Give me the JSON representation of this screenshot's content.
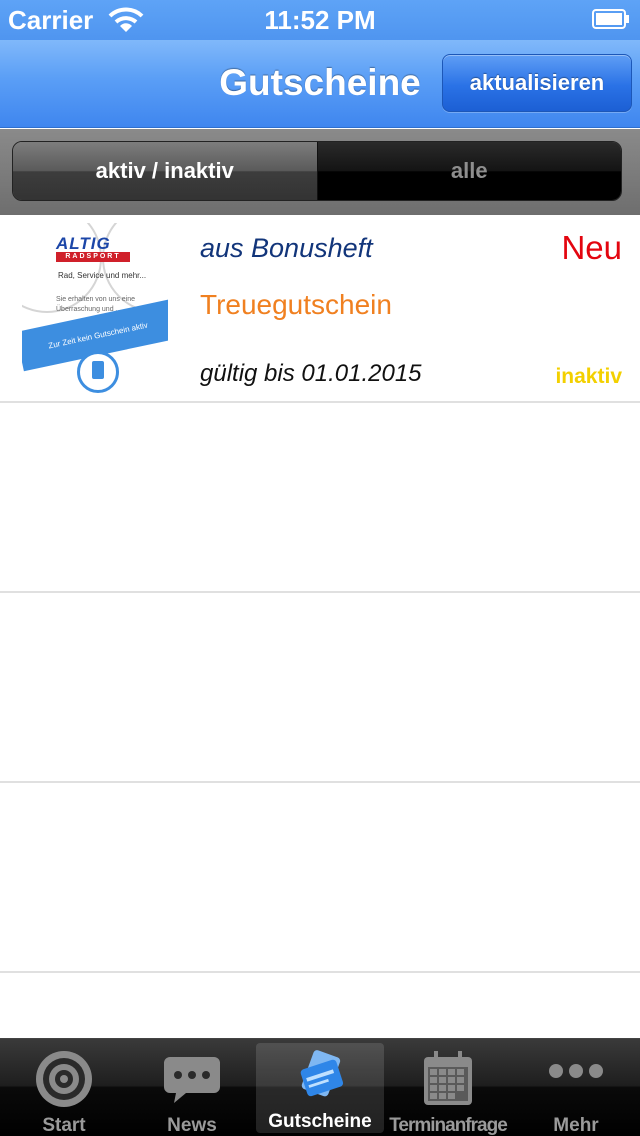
{
  "status_bar": {
    "carrier": "Carrier",
    "time": "11:52 PM"
  },
  "nav_bar": {
    "title": "Gutscheine",
    "refresh_label": "aktualisieren"
  },
  "segment": {
    "items": [
      {
        "label": "aktiv / inaktiv",
        "selected": true
      },
      {
        "label": "alle",
        "selected": false
      }
    ]
  },
  "vouchers": [
    {
      "source": "aus Bonusheft",
      "badge": "Neu",
      "name": "Treuegutschein",
      "valid": "gültig bis 01.01.2015",
      "status": "inaktiv",
      "thumbnail": {
        "logo": "ALTIG",
        "logo_sub": "RADSPORT",
        "tagline": "Rad, Service und mehr...",
        "text_line1": "Sie erhalten von uns eine",
        "text_line2": "Überraschung und ...",
        "banner": "Zur Zeit kein Gutschein aktiv"
      }
    }
  ],
  "tab_bar": {
    "tabs": [
      {
        "label": "Start",
        "icon": "target-icon",
        "selected": false
      },
      {
        "label": "News",
        "icon": "chat-bubble-icon",
        "selected": false
      },
      {
        "label": "Gutscheine",
        "icon": "voucher-cards-icon",
        "selected": true
      },
      {
        "label": "Terminanfrage",
        "icon": "calendar-icon",
        "selected": false
      },
      {
        "label": "Mehr",
        "icon": "more-dots-icon",
        "selected": false
      }
    ]
  },
  "colors": {
    "nav_blue": "#4f95f0",
    "source_text": "#12357a",
    "badge_new": "#e3050f",
    "voucher_name": "#f08020",
    "status_inactive": "#f3d000"
  }
}
